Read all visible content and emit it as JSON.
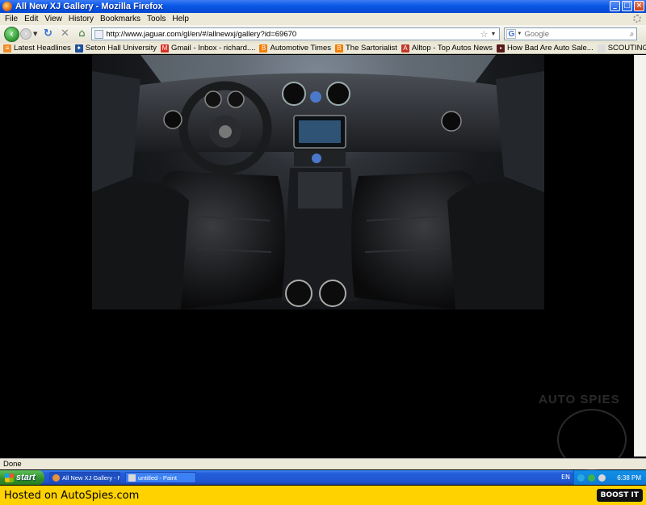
{
  "window": {
    "title": "All New XJ Gallery - Mozilla Firefox",
    "controls": {
      "minimize": "_",
      "maximize": "□",
      "close": "×"
    }
  },
  "menubar": {
    "items": [
      {
        "label": "File"
      },
      {
        "label": "Edit"
      },
      {
        "label": "View"
      },
      {
        "label": "History"
      },
      {
        "label": "Bookmarks"
      },
      {
        "label": "Tools"
      },
      {
        "label": "Help"
      }
    ]
  },
  "navbar": {
    "url": "http://www.jaguar.com/gl/en/#/allnewxj/gallery?id=69670",
    "search_placeholder": "Google"
  },
  "bookmarks": [
    {
      "label": "Latest Headlines",
      "icon": "rss-icon",
      "color": "#f28c28"
    },
    {
      "label": "Seton Hall University",
      "icon": "seton-hall-icon",
      "color": "#1d4f9c"
    },
    {
      "label": "Gmail - Inbox - richard....",
      "icon": "gmail-icon",
      "color": "#d93025"
    },
    {
      "label": "Automotive Times",
      "icon": "blogger-icon",
      "color": "#f57d00"
    },
    {
      "label": "The Sartorialist",
      "icon": "blogger-icon",
      "color": "#f57d00"
    },
    {
      "label": "Alltop - Top Autos News",
      "icon": "alltop-icon",
      "color": "#c0392b"
    },
    {
      "label": "How Bad Are Auto Sale...",
      "icon": "page-dark-icon",
      "color": "#5a1a1a"
    },
    {
      "label": "SCOUTING NY - www.s...",
      "icon": "page-icon",
      "color": "#dddddd"
    }
  ],
  "content": {
    "image_subject": "jaguar-xj-interior-photo",
    "watermark": "AUTO SPIES"
  },
  "statusbar": {
    "text": "Done"
  },
  "taskbar": {
    "start_label": "start",
    "tasks": [
      {
        "label": "All New XJ Gallery - M...",
        "icon": "firefox-icon"
      },
      {
        "label": "untitled - Paint",
        "icon": "paint-icon"
      }
    ],
    "language": "EN",
    "clock": "6:38 PM"
  },
  "hosted_bar": {
    "text": "Hosted on AutoSpies.com",
    "boost_label": "BOOST IT"
  }
}
